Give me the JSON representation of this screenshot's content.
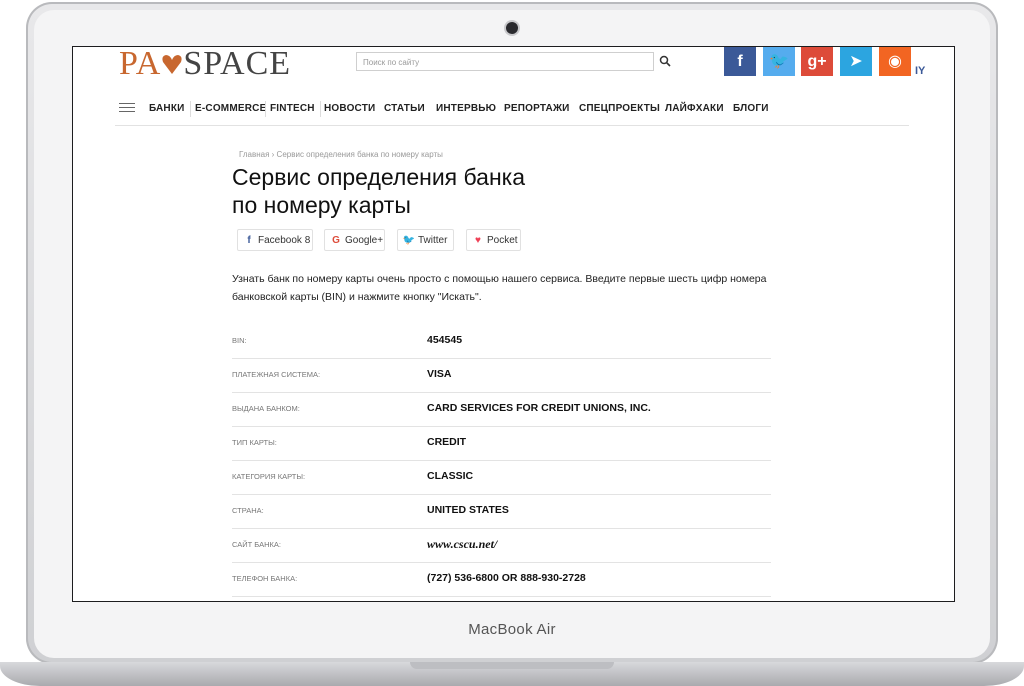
{
  "device": {
    "label": "MacBook Air"
  },
  "header": {
    "logo_part1": "PA",
    "logo_part2": "SPACE",
    "search_placeholder": "Поиск по сайту",
    "social": [
      {
        "icon": "facebook-icon",
        "glyph": "f",
        "color": "#3b5998"
      },
      {
        "icon": "twitter-icon",
        "glyph": "🐦",
        "color": "#55acee"
      },
      {
        "icon": "google-plus-icon",
        "glyph": "g+",
        "color": "#dd4b39"
      },
      {
        "icon": "telegram-icon",
        "glyph": "➤",
        "color": "#2ca5e0"
      },
      {
        "icon": "rss-icon",
        "glyph": "◉",
        "color": "#f26522"
      }
    ],
    "social_cut_text": "IY"
  },
  "nav": {
    "items": [
      "БАНКИ",
      "E-COMMERCE",
      "FINTECH",
      "НОВОСТИ",
      "СТАТЬИ",
      "ИНТЕРВЬЮ",
      "РЕПОРТАЖИ",
      "СПЕЦПРОЕКТЫ",
      "ЛАЙФХАКИ",
      "БЛОГИ"
    ]
  },
  "breadcrumb": "Главная › Сервис определения банка по номеру карты",
  "title_line1": "Сервис определения банка",
  "title_line2": "по номеру карты",
  "share": [
    {
      "label": "Facebook 8",
      "icon": "facebook-icon"
    },
    {
      "label": "Google+",
      "icon": "google-plus-icon"
    },
    {
      "label": "Twitter",
      "icon": "twitter-icon"
    },
    {
      "label": "Pocket",
      "icon": "pocket-icon"
    }
  ],
  "intro": "Узнать банк по номеру карты очень просто с помощью нашего сервиса. Введите первые шесть цифр номера банковской карты (BIN) и нажмите кнопку \"Искать\".",
  "info": [
    {
      "label": "BIN:",
      "value": "454545"
    },
    {
      "label": "Платежная система:",
      "value": "VISA"
    },
    {
      "label": "Выдана банком:",
      "value": "CARD SERVICES FOR CREDIT UNIONS, INC."
    },
    {
      "label": "Тип карты:",
      "value": "CREDIT"
    },
    {
      "label": "Категория карты:",
      "value": "CLASSIC"
    },
    {
      "label": "Страна:",
      "value": "UNITED STATES"
    },
    {
      "label": "Сайт банка:",
      "value": "www.cscu.net/"
    },
    {
      "label": "Телефон банка:",
      "value": "(727) 536-6800 OR 888-930-2728"
    }
  ]
}
